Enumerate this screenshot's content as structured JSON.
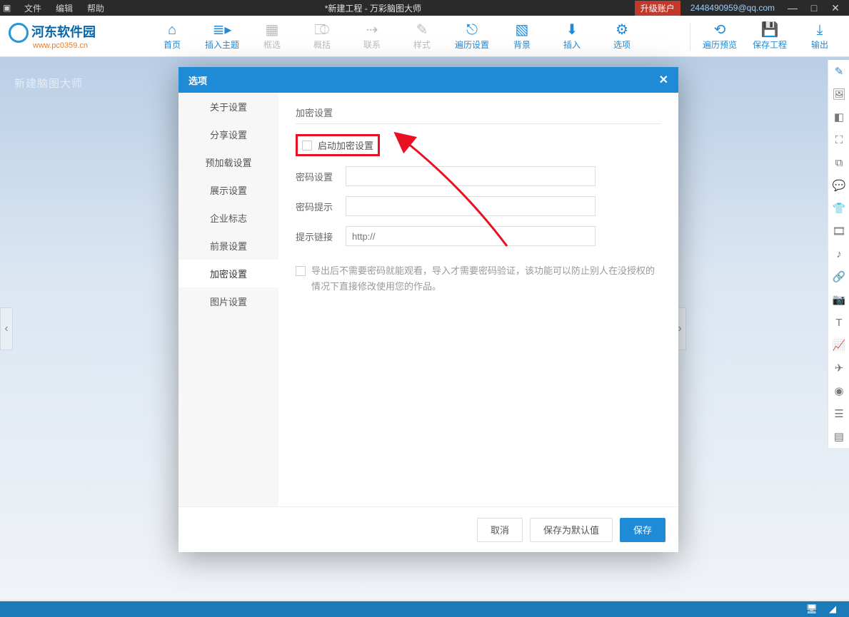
{
  "titlebar": {
    "menu_file": "文件",
    "menu_edit": "编辑",
    "menu_help": "帮助",
    "title": "*新建工程 - 万彩脑图大师",
    "upgrade": "升级账户",
    "account": "2448490959@qq.com"
  },
  "logo": {
    "name": "河东软件园",
    "url": "www.pc0359.cn"
  },
  "ribbon": {
    "home": "首页",
    "insert_topic": "插入主题",
    "frame": "框选",
    "summary": "概括",
    "relation": "联系",
    "style": "样式",
    "playback_settings": "遍历设置",
    "background": "背景",
    "insert": "插入",
    "options": "选项",
    "preview": "遍历预览",
    "save_project": "保存工程",
    "export": "输出"
  },
  "modal": {
    "title": "选项",
    "sidebar": {
      "about": "关于设置",
      "share": "分享设置",
      "preload": "预加载设置",
      "display": "展示设置",
      "corporate": "企业标志",
      "foreground": "前景设置",
      "encryption": "加密设置",
      "image": "图片设置"
    },
    "content": {
      "section_title": "加密设置",
      "enable_checkbox": "启动加密设置",
      "password_label": "密码设置",
      "hint_label": "密码提示",
      "link_label": "提示链接",
      "link_placeholder": "http://",
      "help_text": "导出后不需要密码就能观看，导入才需要密码验证，该功能可以防止别人在没授权的情况下直接修改使用您的作品。"
    },
    "footer": {
      "cancel": "取消",
      "save_default": "保存为默认值",
      "save": "保存"
    }
  },
  "watermark_behind": "新建脑图大师"
}
